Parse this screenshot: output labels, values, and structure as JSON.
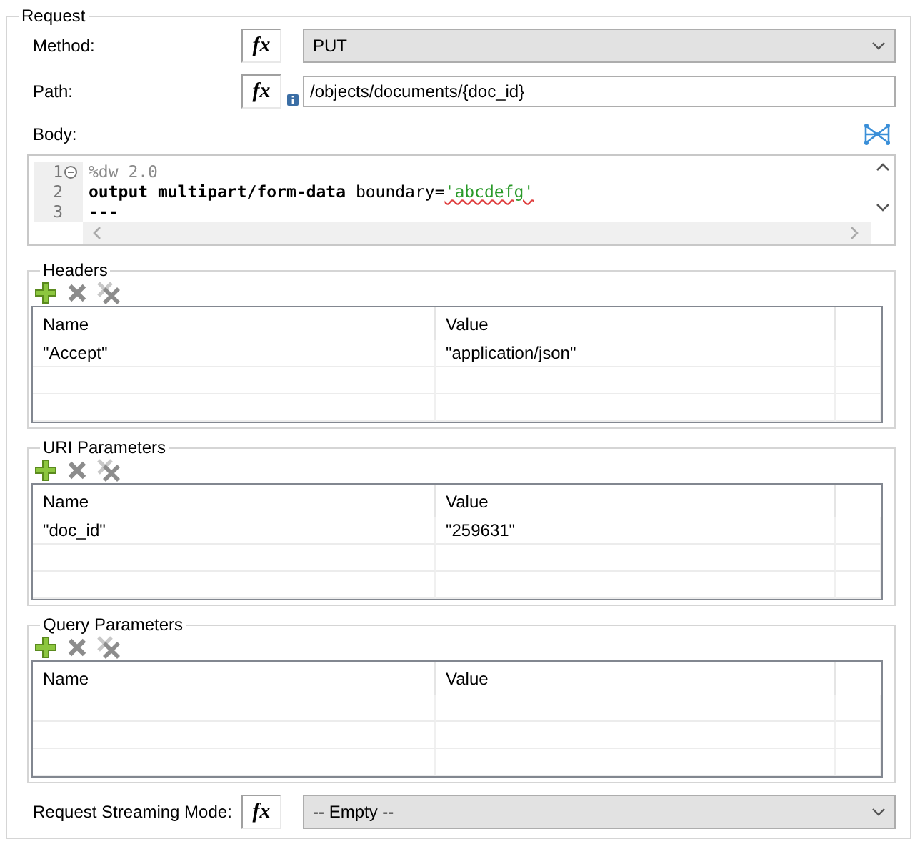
{
  "group_title": "Request",
  "method": {
    "label": "Method:",
    "fx": "fx",
    "value": "PUT"
  },
  "path": {
    "label": "Path:",
    "fx": "fx",
    "value": "/objects/documents/{doc_id}"
  },
  "body": {
    "label": "Body:",
    "lines": [
      {
        "number": "1",
        "foldable": true,
        "segments": [
          {
            "kind": "comment",
            "text": "%dw 2.0"
          }
        ]
      },
      {
        "number": "2",
        "foldable": false,
        "segments": [
          {
            "kind": "keyword",
            "text": "output multipart/form-data"
          },
          {
            "kind": "plain",
            "text": " boundary="
          },
          {
            "kind": "string",
            "text": "'abcdefg'"
          }
        ]
      },
      {
        "number": "3",
        "foldable": false,
        "segments": [
          {
            "kind": "keyword",
            "text": "---"
          }
        ]
      }
    ]
  },
  "sections": [
    {
      "title": "Headers",
      "columns": [
        "Name",
        "Value"
      ],
      "rows": [
        [
          "\"Accept\"",
          "\"application/json\""
        ]
      ]
    },
    {
      "title": "URI Parameters",
      "columns": [
        "Name",
        "Value"
      ],
      "rows": [
        [
          "\"doc_id\"",
          "\"259631\""
        ]
      ]
    },
    {
      "title": "Query Parameters",
      "columns": [
        "Name",
        "Value"
      ]
    }
  ],
  "streaming": {
    "label": "Request Streaming Mode:",
    "fx": "fx",
    "value": "-- Empty --"
  }
}
